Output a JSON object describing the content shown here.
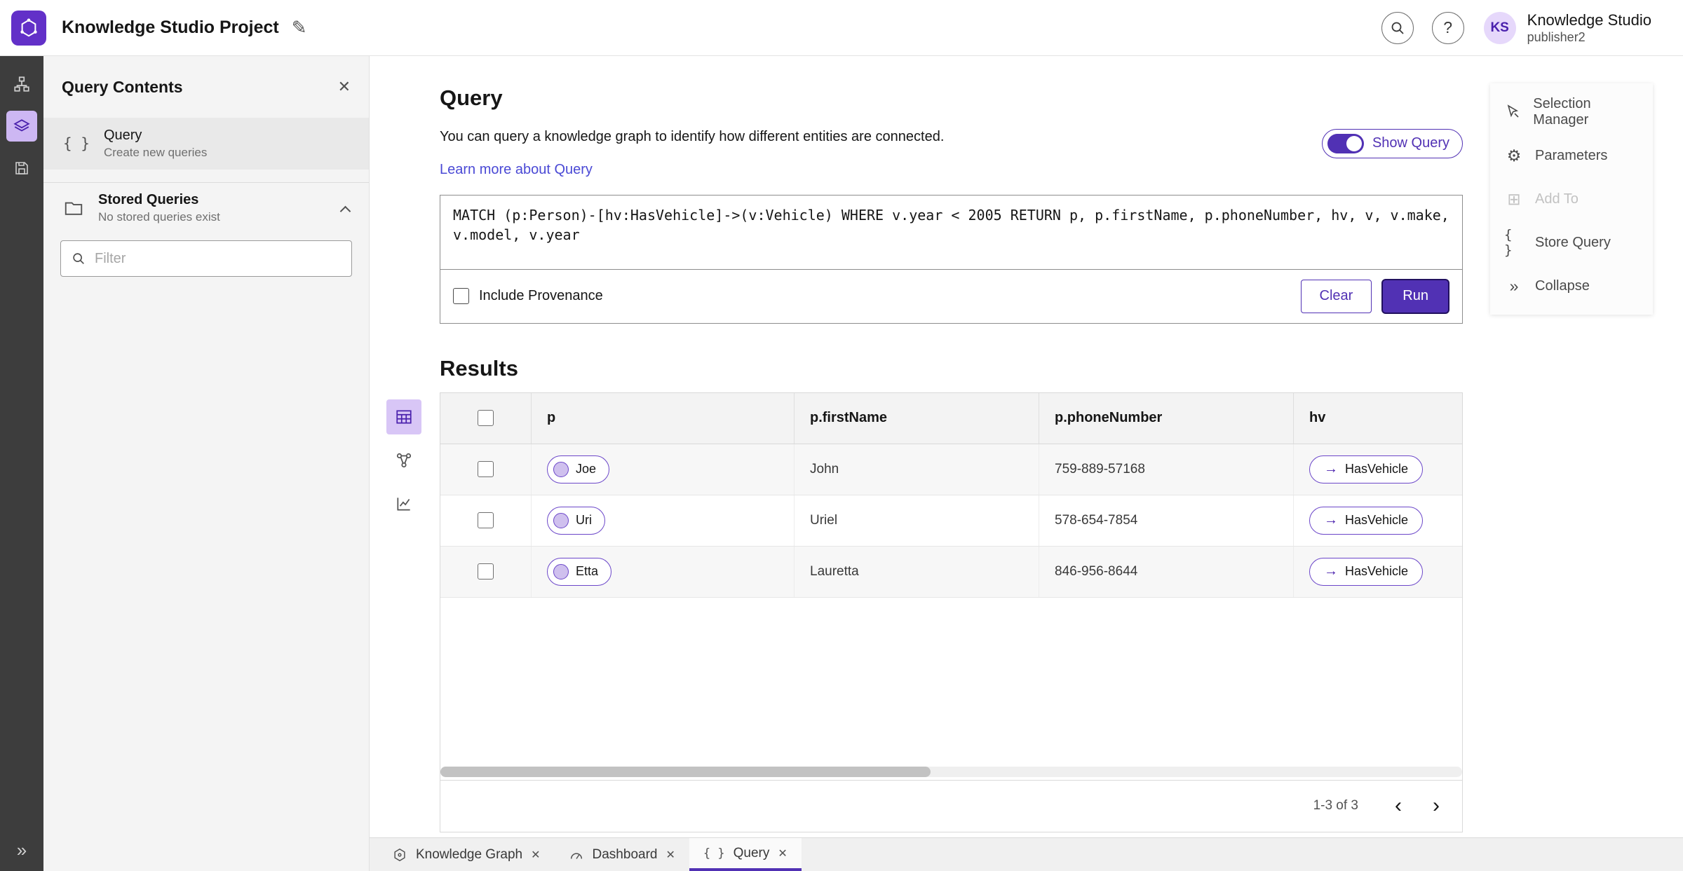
{
  "colors": {
    "accent": "#5131b4",
    "run_button": "#5131b4",
    "link": "#4a49d5",
    "rail_background": "#3d3d3d",
    "selected_tile": "#cdb7f3",
    "node_fill": "#cfc0ee"
  },
  "header": {
    "title": "Knowledge Studio Project",
    "user_initials": "KS",
    "user_product": "Knowledge Studio",
    "user_name": "publisher2"
  },
  "sidebar": {
    "title": "Query Contents",
    "query_item": {
      "label": "Query",
      "description": "Create new queries"
    },
    "stored_queries": {
      "label": "Stored Queries",
      "description": "No stored queries exist"
    },
    "filter_placeholder": "Filter"
  },
  "query_panel": {
    "title": "Query",
    "description": "You can query a knowledge graph to identify how different entities are connected.",
    "learn_more": "Learn more about Query",
    "show_query": "Show Query",
    "query_text": "MATCH (p:Person)-[hv:HasVehicle]->(v:Vehicle) WHERE v.year < 2005 RETURN p, p.firstName, p.phoneNumber, hv, v, v.make, v.model, v.year",
    "include_provenance": "Include Provenance",
    "clear": "Clear",
    "run": "Run"
  },
  "results": {
    "title": "Results",
    "columns": [
      "p",
      "p.firstName",
      "p.phoneNumber",
      "hv"
    ],
    "rows": [
      {
        "p": "Joe",
        "firstName": "John",
        "phoneNumber": "759-889-57168",
        "hv": "HasVehicle"
      },
      {
        "p": "Uri",
        "firstName": "Uriel",
        "phoneNumber": "578-654-7854",
        "hv": "HasVehicle"
      },
      {
        "p": "Etta",
        "firstName": "Lauretta",
        "phoneNumber": "846-956-8644",
        "hv": "HasVehicle"
      }
    ],
    "pagination": "1-3 of 3"
  },
  "context_menu": {
    "items": [
      {
        "label": "Selection Manager"
      },
      {
        "label": "Parameters"
      },
      {
        "label": "Add To",
        "disabled": true
      },
      {
        "label": "Store Query"
      },
      {
        "label": "Collapse"
      }
    ]
  },
  "tabs": [
    {
      "label": "Knowledge Graph"
    },
    {
      "label": "Dashboard"
    },
    {
      "label": "Query",
      "active": true
    }
  ],
  "icons": {
    "edit_pencil": "✎",
    "help": "?",
    "close": "✕",
    "chevron_double_right": "»",
    "braces": "{ }",
    "arrow_right": "→",
    "chevron_left": "‹",
    "chevron_right": "›",
    "gear": "⚙",
    "add_to": "⊞"
  }
}
